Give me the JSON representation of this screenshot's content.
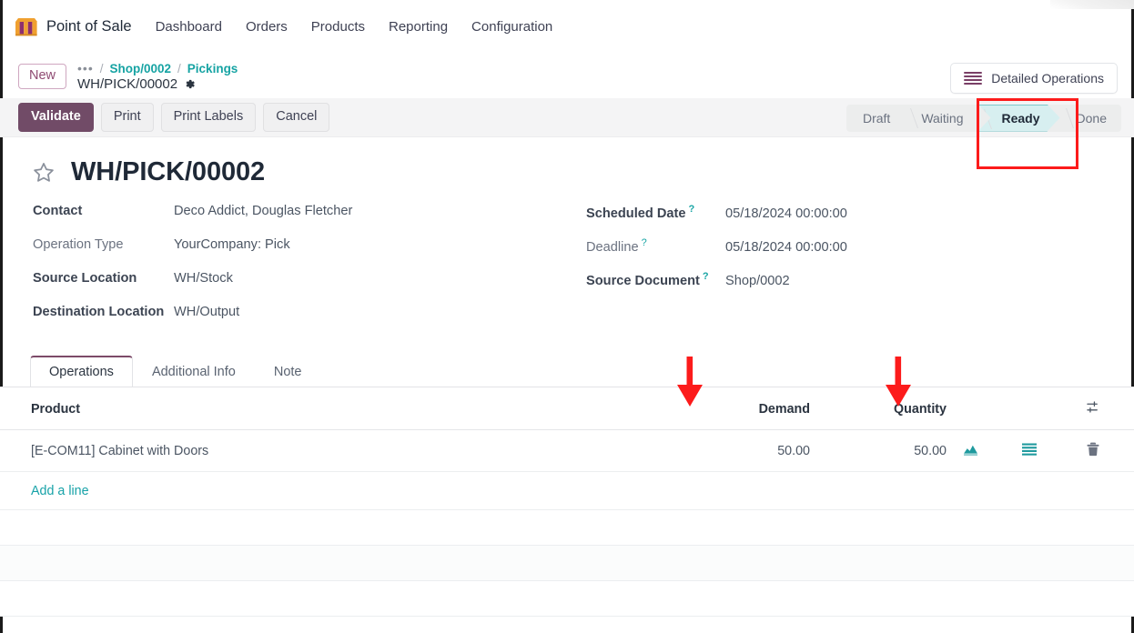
{
  "navbar": {
    "brand": "Point of Sale",
    "logo_icon": "market-stall-icon",
    "menu": [
      {
        "label": "Dashboard"
      },
      {
        "label": "Orders"
      },
      {
        "label": "Products"
      },
      {
        "label": "Reporting"
      },
      {
        "label": "Configuration"
      }
    ]
  },
  "breadcrumb": {
    "new_button": "New",
    "ellipsis": "•••",
    "separator": "/",
    "links": [
      {
        "label": "Shop/0002"
      },
      {
        "label": "Pickings"
      }
    ],
    "current": "WH/PICK/00002",
    "settings_icon": "gear-icon",
    "detailed_operations_button": "Detailed Operations",
    "detailed_operations_icon": "list-lines-icon"
  },
  "toolbar": {
    "validate_label": "Validate",
    "print_label": "Print",
    "print_labels_label": "Print Labels",
    "cancel_label": "Cancel",
    "statuses": [
      {
        "label": "Draft",
        "active": false
      },
      {
        "label": "Waiting",
        "active": false
      },
      {
        "label": "Ready",
        "active": true
      },
      {
        "label": "Done",
        "active": false
      }
    ]
  },
  "record": {
    "favorite_icon": "star-outline-icon",
    "title": "WH/PICK/00002",
    "fields_left": [
      {
        "label": "Contact",
        "value": "Deco Addict, Douglas Fletcher",
        "bold": true,
        "help": false
      },
      {
        "label": "Operation Type",
        "value": "YourCompany: Pick",
        "bold": false,
        "help": false
      },
      {
        "label": "Source Location",
        "value": "WH/Stock",
        "bold": true,
        "help": false
      },
      {
        "label": "Destination Location",
        "value": "WH/Output",
        "bold": true,
        "help": false
      }
    ],
    "fields_right": [
      {
        "label": "Scheduled Date",
        "value": "05/18/2024 00:00:00",
        "bold": true,
        "help": true
      },
      {
        "label": "Deadline",
        "value": "05/18/2024 00:00:00",
        "bold": false,
        "help": true
      },
      {
        "label": "Source Document",
        "value": "Shop/0002",
        "bold": true,
        "help": true
      }
    ],
    "help_marker": "?"
  },
  "tabs": [
    {
      "label": "Operations",
      "active": true
    },
    {
      "label": "Additional Info",
      "active": false
    },
    {
      "label": "Note",
      "active": false
    }
  ],
  "table": {
    "columns": {
      "product": "Product",
      "demand": "Demand",
      "quantity": "Quantity"
    },
    "optional_columns_icon": "column-settings-icon",
    "rows": [
      {
        "product": "[E-COM11] Cabinet with Doors",
        "demand": "50.00",
        "quantity": "50.00",
        "forecast_icon": "forecast-report-icon",
        "details_icon": "detailed-operations-list-icon",
        "delete_icon": "trash-icon"
      }
    ],
    "add_line_label": "Add a line",
    "empty_rows": 3
  },
  "annotations": {
    "highlight_target": "Ready",
    "arrow_targets": [
      "Demand",
      "Quantity"
    ],
    "color": "#fc1b1b"
  },
  "colors": {
    "primary": "#714b67",
    "accent_teal": "#17a2a8",
    "status_ready_fill": "#d7eff0",
    "status_ready_border": "#7ec8ca",
    "toolbar_bg": "#f4f4f5",
    "annotation_red": "#fc1b1b"
  }
}
